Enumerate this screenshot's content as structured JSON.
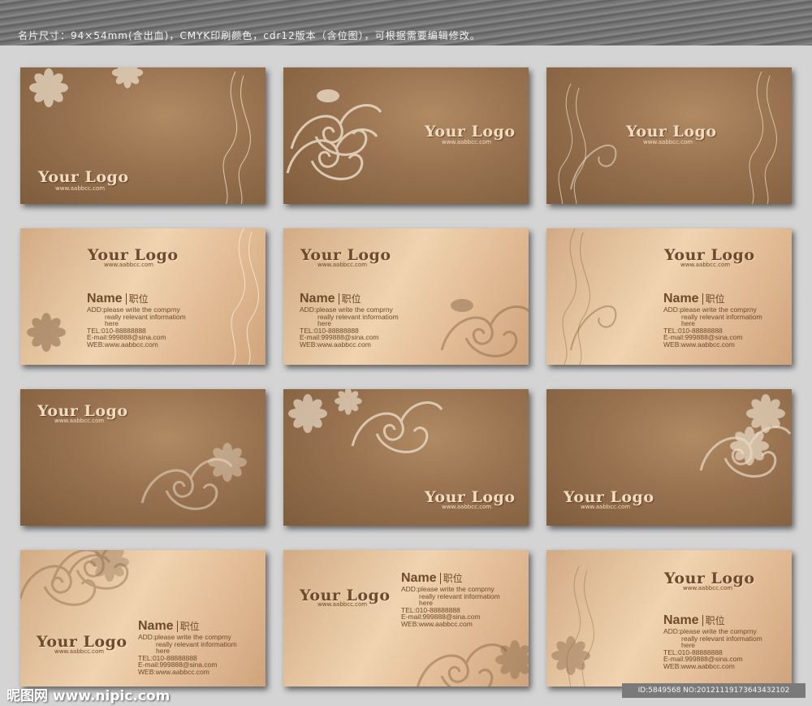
{
  "header": {
    "caption": "名片尺寸：94×54mm(含出血)，CMYK印刷颜色，cdr12版本（含位图），可根据需要编辑修改。"
  },
  "card": {
    "logo": "Your Logo",
    "website": "www.aabbcc.com",
    "name": "Name",
    "title": "职位",
    "address_line1": "ADD:please write the comprny",
    "address_line2": "really relevant informatiom",
    "address_line3": "here",
    "tel": "TEL:010-88888888",
    "email": "E-mail:999888@sina.com",
    "web": "WEB:www.aabbcc.com"
  },
  "watermark": {
    "brand": "昵图网 www.nipic.com",
    "id_text": "ID:5849568 NO:20121119173643432102"
  },
  "colors": {
    "dark_card": "#987250",
    "light_card": "#e9c8a3",
    "ornament_light": "#f3e2cc",
    "ornament_dark": "#8a6a4c",
    "text_brown": "#6e4a2c"
  }
}
